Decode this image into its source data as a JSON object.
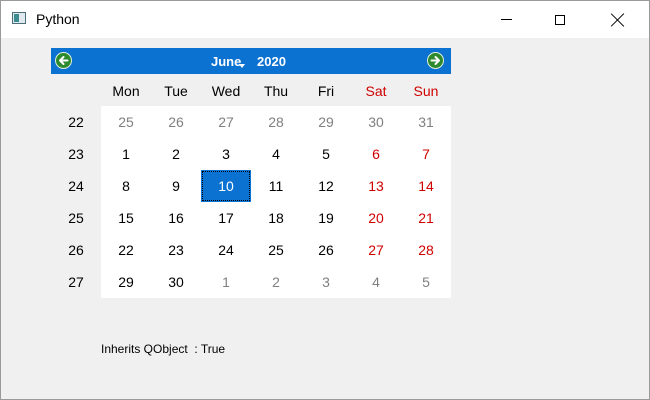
{
  "window": {
    "title": "Python",
    "icon": "app-window-icon"
  },
  "calendar": {
    "month": "June",
    "year": "2020",
    "days_of_week": [
      "Mon",
      "Tue",
      "Wed",
      "Thu",
      "Fri",
      "Sat",
      "Sun"
    ],
    "weekend_color": "#d00000",
    "accent_color": "#0b72d2",
    "weeks": [
      {
        "week": "22",
        "days": [
          "25",
          "26",
          "27",
          "28",
          "29",
          "30",
          "31"
        ],
        "other": [
          true,
          true,
          true,
          true,
          true,
          true,
          true
        ]
      },
      {
        "week": "23",
        "days": [
          "1",
          "2",
          "3",
          "4",
          "5",
          "6",
          "7"
        ],
        "other": [
          false,
          false,
          false,
          false,
          false,
          false,
          false
        ]
      },
      {
        "week": "24",
        "days": [
          "8",
          "9",
          "10",
          "11",
          "12",
          "13",
          "14"
        ],
        "other": [
          false,
          false,
          false,
          false,
          false,
          false,
          false
        ]
      },
      {
        "week": "25",
        "days": [
          "15",
          "16",
          "17",
          "18",
          "19",
          "20",
          "21"
        ],
        "other": [
          false,
          false,
          false,
          false,
          false,
          false,
          false
        ]
      },
      {
        "week": "26",
        "days": [
          "22",
          "23",
          "24",
          "25",
          "26",
          "27",
          "28"
        ],
        "other": [
          false,
          false,
          false,
          false,
          false,
          false,
          false
        ]
      },
      {
        "week": "27",
        "days": [
          "29",
          "30",
          "1",
          "2",
          "3",
          "4",
          "5"
        ],
        "other": [
          false,
          false,
          true,
          true,
          true,
          true,
          true
        ]
      }
    ],
    "selected": "10"
  },
  "status": {
    "text": "Inherits QObject  : True"
  }
}
